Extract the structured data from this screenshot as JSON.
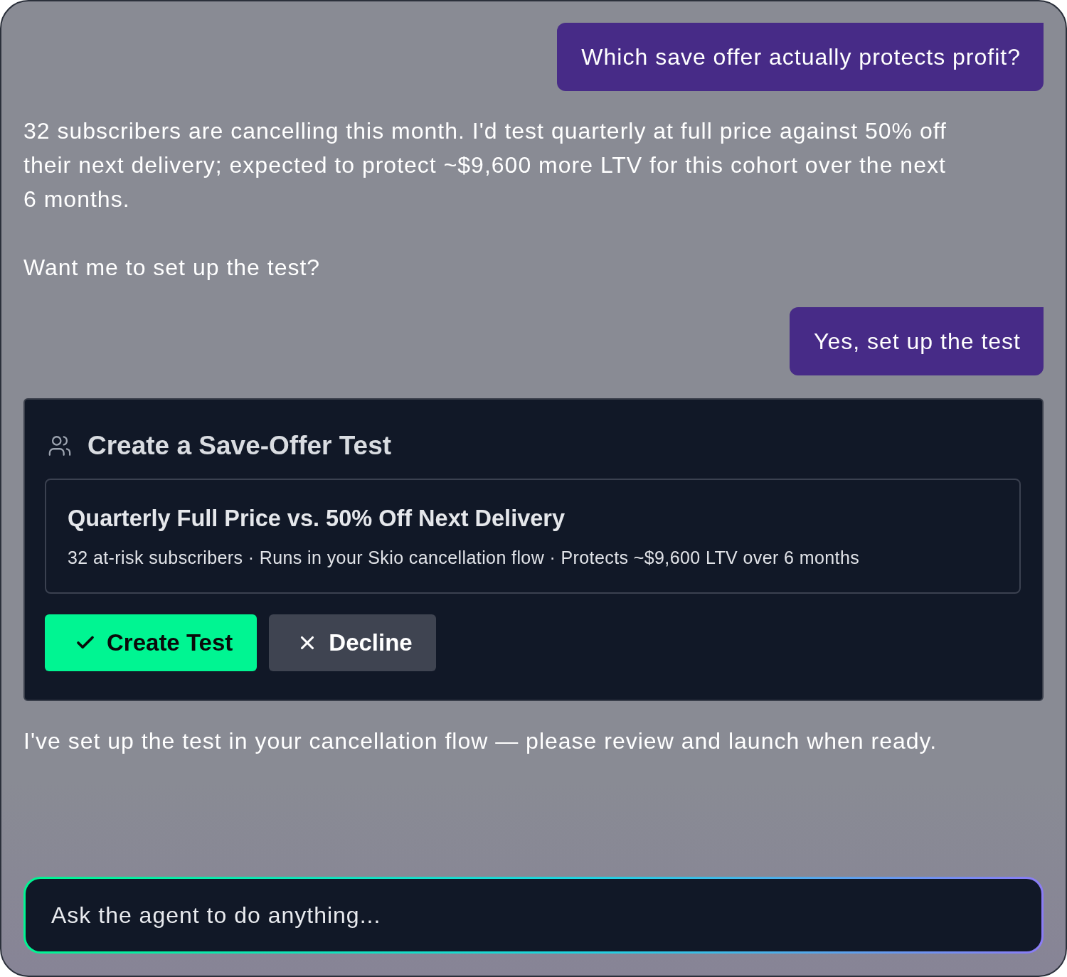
{
  "messages": [
    {
      "kind": "user",
      "text": "Which save offer actually protects profit?"
    },
    {
      "kind": "assistant",
      "paragraphs": [
        "32 subscribers are cancelling this month. I'd test quarterly at full price against 50% off their next delivery; expected to protect ~$9,600 more LTV for this cohort over the next 6 months.",
        "Want me to set up the test?"
      ]
    },
    {
      "kind": "user",
      "text": "Yes, set up the test"
    },
    {
      "kind": "action_card",
      "title": "Create a Save-Offer Test",
      "offer": {
        "title": "Quarterly Full Price vs. 50% Off Next Delivery",
        "details": "32 at-risk subscribers · Runs in your Skio cancellation flow · Protects ~$9,600 LTV over 6 months"
      },
      "buttons": [
        {
          "kind": "confirm",
          "label": "Create Test"
        },
        {
          "kind": "decline",
          "label": "Decline"
        }
      ]
    },
    {
      "kind": "assistant",
      "paragraphs": [
        "I've set up the test in your cancellation flow — please review and launch when ready."
      ]
    }
  ],
  "composer": {
    "placeholder": "Ask the agent to do anything..."
  }
}
